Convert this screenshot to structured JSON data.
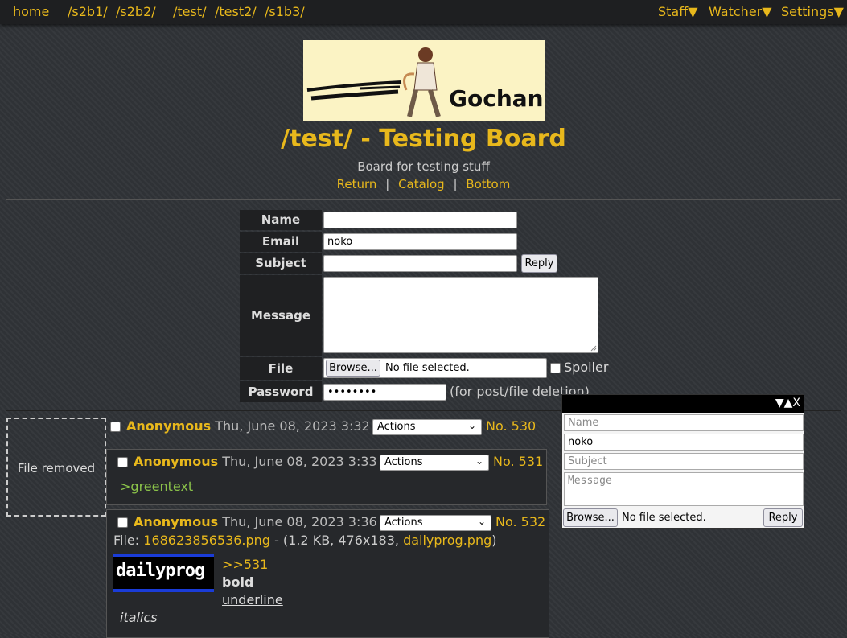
{
  "nav": {
    "home": "home",
    "boards": [
      "/s2b1/",
      "/s2b2/",
      "/test/",
      "/test2/",
      "/s1b3/"
    ],
    "staff": "Staff▼",
    "watcher": "Watcher▼",
    "settings": "Settings▼"
  },
  "banner": {
    "text": "Gochan"
  },
  "header": {
    "title": "/test/ - Testing Board",
    "subtitle": "Board for testing stuff",
    "links": [
      "Return",
      "Catalog",
      "Bottom"
    ],
    "separator": "|"
  },
  "form": {
    "name_label": "Name",
    "email_label": "Email",
    "email_value": "noko",
    "subject_label": "Subject",
    "reply_button": "Reply",
    "message_label": "Message",
    "file_label": "File",
    "browse_button": "Browse...",
    "file_status": "No file selected.",
    "spoiler_label": "Spoiler",
    "password_label": "Password",
    "password_value": "••••••••",
    "password_note": "(for post/file deletion)"
  },
  "op": {
    "file_removed": "File removed",
    "name": "Anonymous",
    "date": "Thu, June 08, 2023 3:32 PM",
    "actions": "Actions",
    "number": "No. 530"
  },
  "replies": [
    {
      "name": "Anonymous",
      "date": "Thu, June 08, 2023 3:33 PM",
      "actions": "Actions",
      "number": "No. 531",
      "greentext": ">greentext"
    },
    {
      "name": "Anonymous",
      "date": "Thu, June 08, 2023 3:36 PM",
      "actions": "Actions",
      "number": "No. 532",
      "file_prefix": "File:",
      "file_name": "168623856536.png",
      "file_meta": "- (1.2 KB, 476x183,",
      "file_original": "dailyprog.png",
      "file_close": ")",
      "thumb_text": "dailyprog",
      "quote": ">>531",
      "bold": "bold",
      "underline": "underline",
      "italics": "italics"
    }
  ],
  "quick_reply": {
    "controls": "▼▲X",
    "name_placeholder": "Name",
    "email_value": "noko",
    "subject_placeholder": "Subject",
    "message_placeholder": "Message",
    "browse_button": "Browse...",
    "file_status": "No file selected.",
    "reply_button": "Reply"
  },
  "colors": {
    "accent": "#e8b81c",
    "greentext": "#8bc34a",
    "background": "#2f3236"
  }
}
